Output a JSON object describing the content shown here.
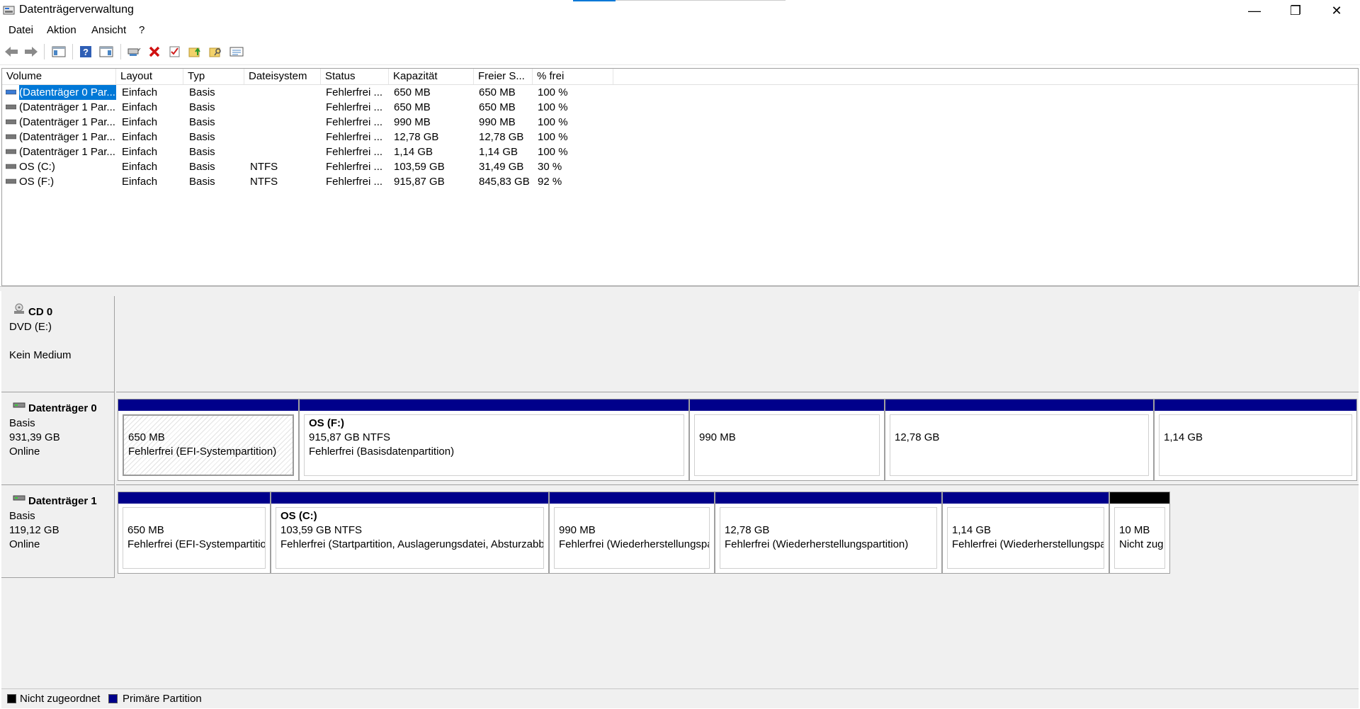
{
  "window": {
    "title": "Datenträgerverwaltung",
    "minimize": "—",
    "maximize": "❐",
    "close": "✕"
  },
  "menu": [
    "Datei",
    "Aktion",
    "Ansicht",
    "?"
  ],
  "toolbar": [
    "back-icon",
    "forward-icon",
    "console-tree-icon",
    "help-icon",
    "properties-icon",
    "connect-icon",
    "delete-icon",
    "check-icon",
    "folder-up-icon",
    "folder-search-icon",
    "view-icon"
  ],
  "volume_list": {
    "columns": [
      "Volume",
      "Layout",
      "Typ",
      "Dateisystem",
      "Status",
      "Kapazität",
      "Freier S...",
      "% frei"
    ],
    "rows": [
      {
        "volume": "(Datenträger 0 Par...",
        "layout": "Einfach",
        "typ": "Basis",
        "fs": "",
        "status": "Fehlerfrei ...",
        "cap": "650 MB",
        "free": "650 MB",
        "pct": "100 %"
      },
      {
        "volume": "(Datenträger 1 Par...",
        "layout": "Einfach",
        "typ": "Basis",
        "fs": "",
        "status": "Fehlerfrei ...",
        "cap": "650 MB",
        "free": "650 MB",
        "pct": "100 %"
      },
      {
        "volume": "(Datenträger 1 Par...",
        "layout": "Einfach",
        "typ": "Basis",
        "fs": "",
        "status": "Fehlerfrei ...",
        "cap": "990 MB",
        "free": "990 MB",
        "pct": "100 %"
      },
      {
        "volume": "(Datenträger 1 Par...",
        "layout": "Einfach",
        "typ": "Basis",
        "fs": "",
        "status": "Fehlerfrei ...",
        "cap": "12,78 GB",
        "free": "12,78 GB",
        "pct": "100 %"
      },
      {
        "volume": "(Datenträger 1 Par...",
        "layout": "Einfach",
        "typ": "Basis",
        "fs": "",
        "status": "Fehlerfrei ...",
        "cap": "1,14 GB",
        "free": "1,14 GB",
        "pct": "100 %"
      },
      {
        "volume": "OS (C:)",
        "layout": "Einfach",
        "typ": "Basis",
        "fs": "NTFS",
        "status": "Fehlerfrei ...",
        "cap": "103,59 GB",
        "free": "31,49 GB",
        "pct": "30 %"
      },
      {
        "volume": "OS (F:)",
        "layout": "Einfach",
        "typ": "Basis",
        "fs": "NTFS",
        "status": "Fehlerfrei ...",
        "cap": "915,87 GB",
        "free": "845,83 GB",
        "pct": "92 %"
      }
    ]
  },
  "disks": [
    {
      "name": "CD 0",
      "lines": [
        "DVD (E:)",
        "",
        "Kein Medium"
      ],
      "partitions": []
    },
    {
      "name": "Datenträger 0",
      "lines": [
        "Basis",
        "931,39 GB",
        "Online"
      ],
      "partitions": [
        {
          "title": "",
          "line1": "650 MB",
          "line2": "Fehlerfrei (EFI-Systempartition)"
        },
        {
          "title": "OS  (F:)",
          "line1": "915,87 GB NTFS",
          "line2": "Fehlerfrei (Basisdatenpartition)"
        },
        {
          "title": "",
          "line1": "990 MB",
          "line2": ""
        },
        {
          "title": "",
          "line1": "12,78 GB",
          "line2": ""
        },
        {
          "title": "",
          "line1": "1,14 GB",
          "line2": ""
        }
      ]
    },
    {
      "name": "Datenträger 1",
      "lines": [
        "Basis",
        "119,12 GB",
        "Online"
      ],
      "partitions": [
        {
          "title": "",
          "line1": "650 MB",
          "line2": "Fehlerfrei (EFI-Systempartition"
        },
        {
          "title": "OS  (C:)",
          "line1": "103,59 GB NTFS",
          "line2": "Fehlerfrei (Startpartition, Auslagerungsdatei, Absturzabb"
        },
        {
          "title": "",
          "line1": "990 MB",
          "line2": "Fehlerfrei (Wiederherstellungspa"
        },
        {
          "title": "",
          "line1": "12,78 GB",
          "line2": "Fehlerfrei (Wiederherstellungspartition)"
        },
        {
          "title": "",
          "line1": "1,14 GB",
          "line2": "Fehlerfrei (Wiederherstellungspar"
        },
        {
          "title": "",
          "line1": "10 MB",
          "line2": "Nicht zug"
        }
      ]
    }
  ],
  "legend": [
    {
      "label": "Nicht zugeordnet",
      "color": "#000000"
    },
    {
      "label": "Primäre Partition",
      "color": "#00008b"
    }
  ]
}
